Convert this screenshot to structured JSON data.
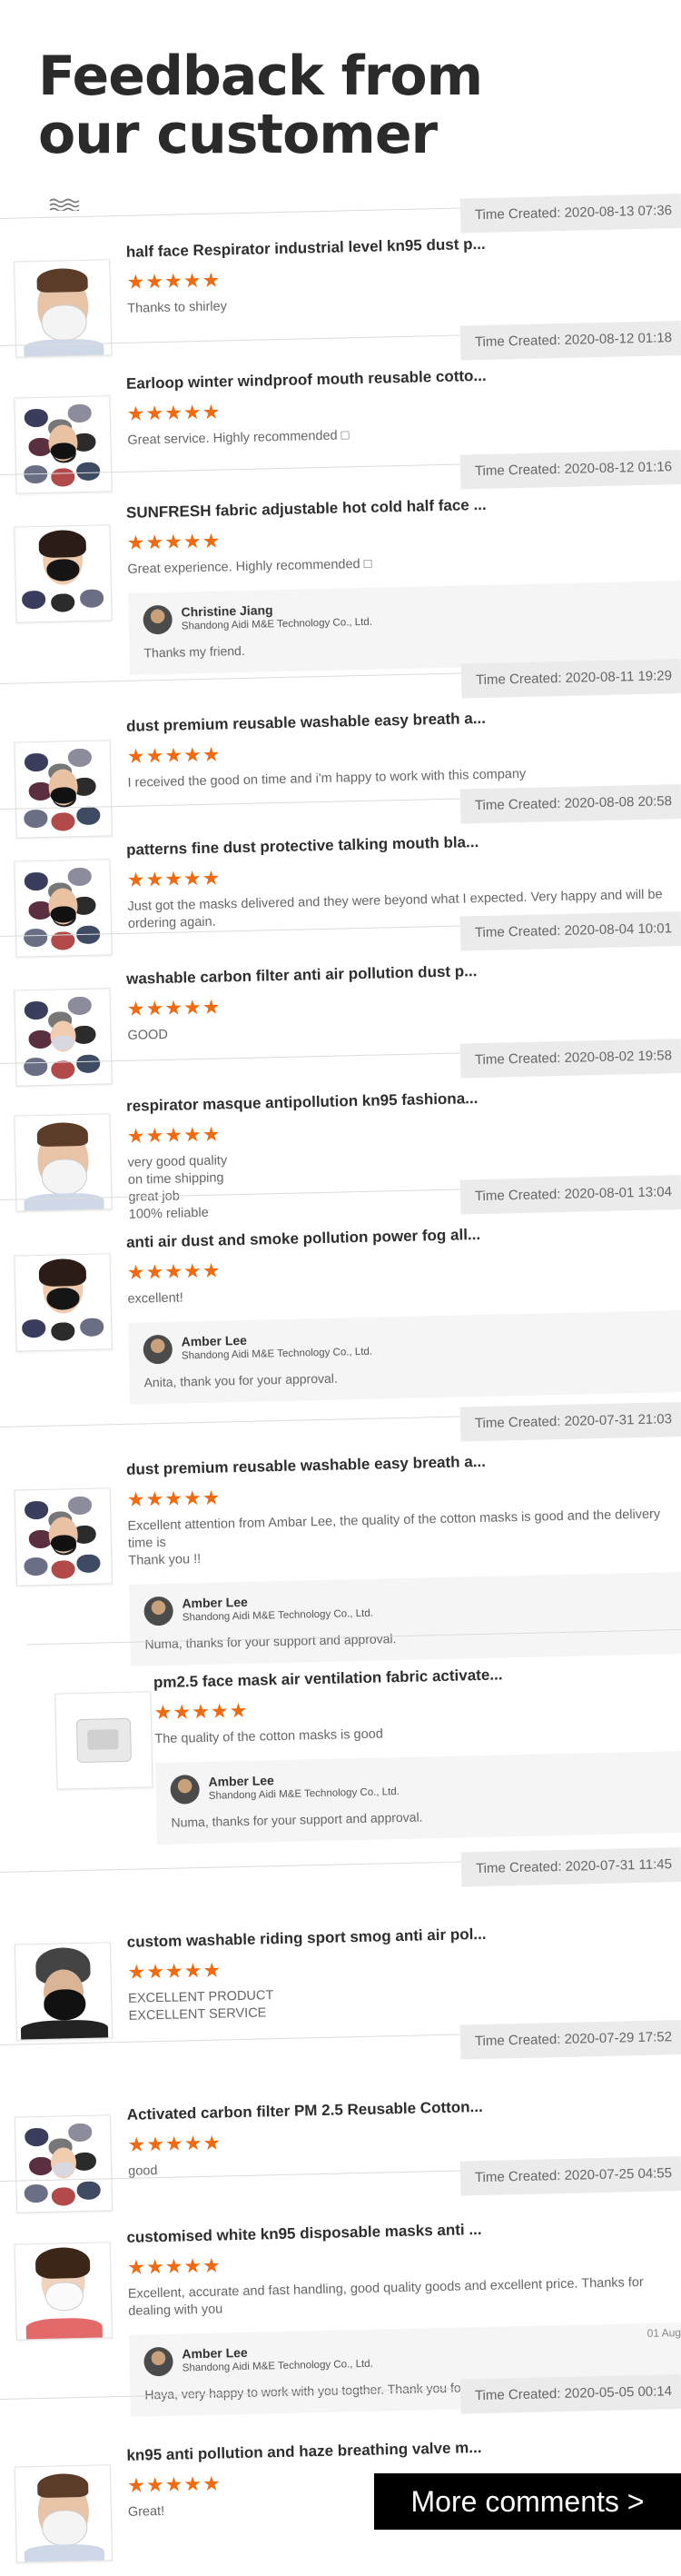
{
  "header": {
    "title_line1": "Feedback from",
    "title_line2": "our customer"
  },
  "colors": {
    "star": "#f26a10",
    "badge_bg": "#ebebeb",
    "button_bg": "#000000"
  },
  "feedback": [
    {
      "time": "Time Created: 2020-08-13 07:36",
      "product": "half face Respirator industrial level kn95 dust p...",
      "rating": 5,
      "comment": "Thanks to shirley",
      "thumb": "white-mask-man"
    },
    {
      "time": "Time Created: 2020-08-12 01:18",
      "product": "Earloop winter windproof mouth reusable cotto...",
      "rating": 5,
      "comment": "Great service. Highly recommended □",
      "thumb": "cloth-masks"
    },
    {
      "time": "Time Created: 2020-08-12 01:16",
      "product": "SUNFRESH fabric adjustable hot cold half face ...",
      "rating": 5,
      "comment": "Great experience. Highly recommended □",
      "thumb": "woman-black-mask",
      "reply": {
        "name": "Christine Jiang",
        "company": "Shandong Aidi M&E Technology Co., Ltd.",
        "text": "Thanks my friend."
      }
    },
    {
      "time": "Time Created: 2020-08-11 19:29",
      "product": "dust premium reusable washable easy breath a...",
      "rating": 5,
      "comment": "I received the good on time and i'm happy to work with this company",
      "thumb": "cloth-masks"
    },
    {
      "time": "Time Created: 2020-08-08 20:58",
      "product": "patterns fine dust protective talking mouth bla...",
      "rating": 5,
      "comment": "Just got the masks delivered and they were beyond what I expected. Very happy and will be ordering again.",
      "thumb": "cloth-masks"
    },
    {
      "time": "Time Created: 2020-08-04 10:01",
      "product": "washable carbon filter anti air pollution dust p...",
      "rating": 5,
      "comment": "GOOD",
      "thumb": "woman-masks"
    },
    {
      "time": "Time Created: 2020-08-02 19:58",
      "product": "respirator masque antipollution kn95 fashiona...",
      "rating": 5,
      "comment": "very good quality\non time shipping\ngreat job\n100% reliable",
      "thumb": "white-mask-man"
    },
    {
      "time": "Time Created: 2020-08-01 13:04",
      "product": "anti air dust and smoke pollution power fog all...",
      "rating": 5,
      "comment": "excellent!",
      "thumb": "woman-black-mask",
      "reply": {
        "name": "Amber Lee",
        "company": "Shandong Aidi M&E Technology Co., Ltd.",
        "text": "Anita, thank you for your approval."
      }
    },
    {
      "time": "Time Created: 2020-07-31 21:03",
      "product": "dust premium reusable washable easy breath a...",
      "rating": 5,
      "comment": "Excellent attention from Ambar Lee, the quality of the cotton masks is good and the delivery time is\nThank you !!",
      "thumb": "cloth-masks",
      "reply": {
        "name": "Amber Lee",
        "company": "Shandong Aidi M&E Technology Co., Ltd.",
        "text": "Numa, thanks for your support and approval."
      }
    },
    {
      "time": "",
      "product": "pm2.5 face mask air ventilation fabric activate...",
      "rating": 5,
      "comment": "The quality of the cotton masks is good",
      "thumb": "filter-pad",
      "reply": {
        "name": "Amber Lee",
        "company": "Shandong Aidi M&E Technology Co., Ltd.",
        "text": "Numa, thanks for your support and approval."
      }
    },
    {
      "time": "Time Created: 2020-07-31 11:45",
      "product": "custom washable riding sport smog anti air pol...",
      "rating": 5,
      "comment": "EXCELLENT PRODUCT\nEXCELLENT SERVICE",
      "thumb": "rider-mask"
    },
    {
      "time": "Time Created: 2020-07-29 17:52",
      "product": "Activated carbon filter PM 2.5 Reusable Cotton...",
      "rating": 5,
      "comment": "good",
      "thumb": "woman-masks"
    },
    {
      "time": "Time Created: 2020-07-25 04:55",
      "product": "customised white kn95 disposable masks anti ...",
      "rating": 5,
      "comment": "Excellent, accurate and fast handling, good quality goods and excellent price. Thanks for dealing with you",
      "thumb": "woman-white-mask",
      "reply": {
        "name": "Amber Lee",
        "company": "Shandong Aidi M&E Technology Co., Ltd.",
        "text": "Haya, very happy to work with you togther. Thank you for your approval.",
        "date": "01 Aug"
      }
    },
    {
      "time": "Time Created: 2020-05-05 00:14",
      "product": "kn95 anti pollution and haze breathing valve m...",
      "rating": 5,
      "comment": "Great!",
      "thumb": "white-mask-man"
    }
  ],
  "more_button": "More comments >"
}
